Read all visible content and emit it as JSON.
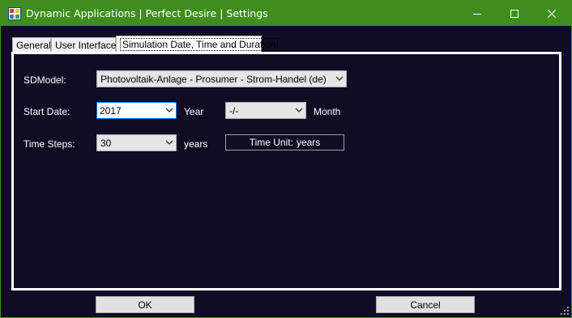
{
  "window": {
    "title": "Dynamic Applications | Perfect Desire | Settings",
    "titlebar_color": "#3f8e1d",
    "background_color": "#100c24"
  },
  "tabs": [
    {
      "label": "General",
      "selected": false
    },
    {
      "label": "User Interface",
      "selected": false
    },
    {
      "label": "Simulation Date, Time and Duration",
      "selected": true
    }
  ],
  "form": {
    "sdmodel_label": "SDModel:",
    "sdmodel_value": "Photovoltaik-Anlage - Prosumer - Strom-Handel (de)",
    "start_date_label": "Start Date:",
    "start_year_value": "2017",
    "year_label": "Year",
    "start_month_value": "-/-",
    "month_label": "Month",
    "time_steps_label": "Time Steps:",
    "time_steps_value": "30",
    "time_steps_unit": "years",
    "time_unit_label": "Time Unit:",
    "time_unit_value": "years"
  },
  "buttons": {
    "ok_label": "OK",
    "cancel_label": "Cancel"
  }
}
